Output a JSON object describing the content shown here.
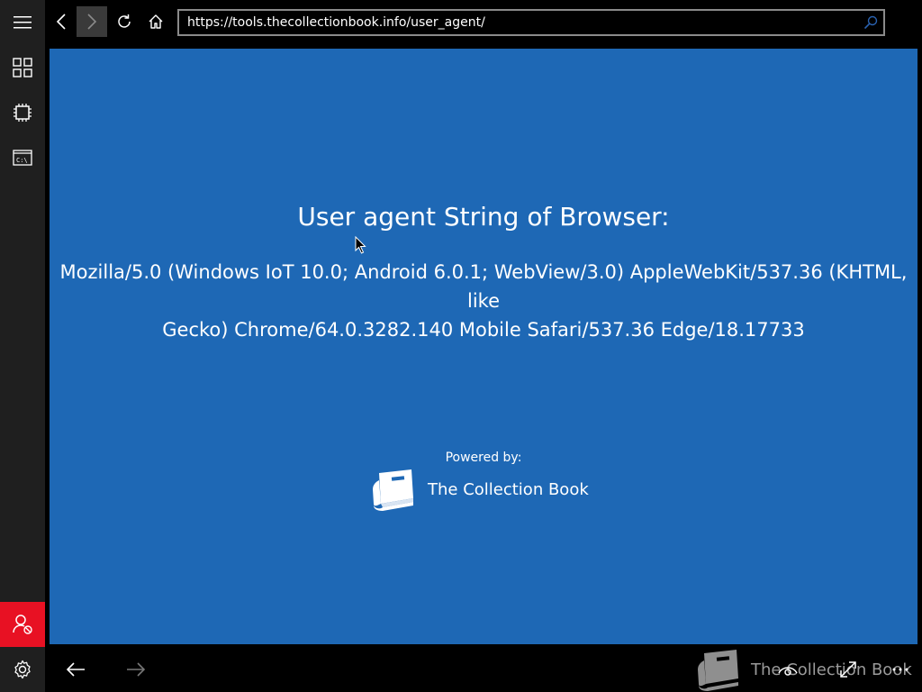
{
  "browser": {
    "address_url": "https://tools.thecollectionbook.info/user_agent/"
  },
  "page": {
    "title": "User agent String of Browser:",
    "user_agent_line1": "Mozilla/5.0 (Windows IoT 10.0; Android 6.0.1; WebView/3.0) AppleWebKit/537.36 (KHTML, like",
    "user_agent_line2": "Gecko) Chrome/64.0.3282.140 Mobile Safari/537.36 Edge/18.17733",
    "powered_by": "Powered by:",
    "brand_name": "The Collection Book"
  },
  "bottom": {
    "watermark_text": "The Collection Book"
  },
  "colors": {
    "content_background": "#1e68b5",
    "sidebar_background": "#1f1f1f",
    "alert_red": "#e81123"
  },
  "icons": {
    "sidebar": [
      "hamburger-menu-icon",
      "tiles-grid-icon",
      "chip-icon",
      "command-prompt-icon",
      "user-alert-icon",
      "gear-icon"
    ],
    "topbar": [
      "back-arrow-icon",
      "forward-arrow-icon",
      "refresh-icon",
      "home-icon",
      "search-icon"
    ],
    "bottom": [
      "back-arrow-icon",
      "forward-arrow-icon",
      "book-icon",
      "eye-icon",
      "expand-icon",
      "more-icon"
    ]
  }
}
